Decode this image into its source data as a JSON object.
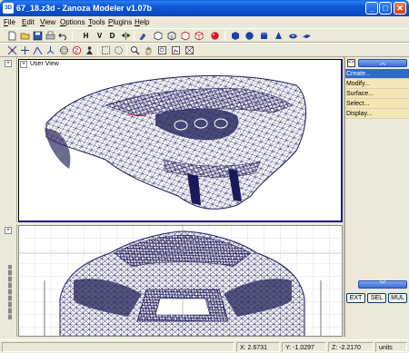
{
  "window": {
    "app_icon": "3D",
    "title": "67_18.z3d - Zanoza Modeler v1.07b",
    "minimize_glyph": "_",
    "maximize_glyph": "□",
    "close_glyph": "✕"
  },
  "menu": [
    "File",
    "Edit",
    "View",
    "Options",
    "Tools",
    "Plugins",
    "Help"
  ],
  "toolbar": {
    "letter_h": "H",
    "letter_v": "V",
    "letter_d": "D",
    "icons_row1": [
      "new-file-icon",
      "open-file-icon",
      "save-icon",
      "print-icon",
      "undo-icon",
      "redo-icon",
      "mirror-icon",
      "paint-icon",
      "cube-front-icon",
      "cube-side-icon",
      "cube-top-icon",
      "cube-persp-icon",
      "sphere-red-icon",
      "cube-blue-icon",
      "cylinder-icon",
      "cone-icon",
      "torus-icon",
      "plane-icon"
    ],
    "icons_row2": [
      "move-axis-icon",
      "rotate-icon",
      "scale-icon",
      "link-icon",
      "zoom-z-icon",
      "select-rect-icon",
      "select-circle-icon",
      "magnify-icon",
      "hand-pan-icon",
      "zoom-extents-icon",
      "render-icon",
      "fit-icon"
    ]
  },
  "viewports": {
    "top_label": "User View",
    "corner_glyph": "+"
  },
  "command_panel": {
    "top_button": "<>",
    "up_arrow": "︽",
    "down_arrow": "︾",
    "items": [
      {
        "label": "Create...",
        "active": true
      },
      {
        "label": "Modify...",
        "active": false
      },
      {
        "label": "Surface...",
        "active": false
      },
      {
        "label": "Select...",
        "active": false
      },
      {
        "label": "Display...",
        "active": false
      }
    ],
    "buttons": [
      "EXT",
      "SEL",
      "MUL"
    ]
  },
  "status": {
    "x": "X: 2.6731",
    "y": "Y: -1.0297",
    "z": "Z: -2.2170",
    "units": "units"
  },
  "colors": {
    "title_blue": "#0a4cc8",
    "wire_dark": "#1a1a5a",
    "active_item": "#316ac5",
    "item_bg": "#f4e7b4"
  }
}
